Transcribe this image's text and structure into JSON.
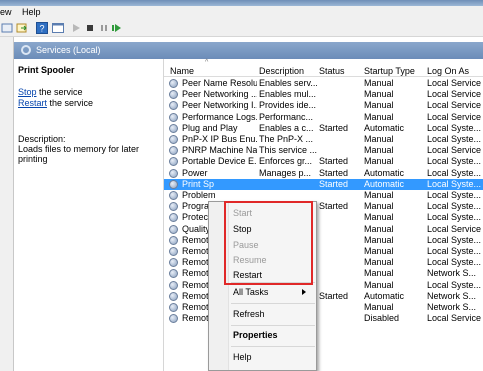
{
  "menu": {
    "view_label": "ew",
    "help_label": "Help"
  },
  "header": {
    "title": "Services (Local)"
  },
  "description_panel": {
    "service_title": "Print Spooler",
    "stop_link": "Stop",
    "stop_suffix": " the service",
    "restart_link": "Restart",
    "restart_suffix": " the service",
    "description_label": "Description:",
    "description_line1": "Loads files to memory for later",
    "description_line2": "printing"
  },
  "columns": {
    "name": "Name",
    "description": "Description",
    "status": "Status",
    "startup_type": "Startup Type",
    "log_on_as": "Log On As"
  },
  "rows": [
    {
      "name": "Peer Name Resolu...",
      "description": "Enables serv...",
      "status": "",
      "startup": "Manual",
      "logon": "Local Service"
    },
    {
      "name": "Peer Networking ...",
      "description": "Enables mul...",
      "status": "",
      "startup": "Manual",
      "logon": "Local Service"
    },
    {
      "name": "Peer Networking I...",
      "description": "Provides ide...",
      "status": "",
      "startup": "Manual",
      "logon": "Local Service"
    },
    {
      "name": "Performance Logs...",
      "description": "Performanc...",
      "status": "",
      "startup": "Manual",
      "logon": "Local Service"
    },
    {
      "name": "Plug and Play",
      "description": "Enables a c...",
      "status": "Started",
      "startup": "Automatic",
      "logon": "Local Syste..."
    },
    {
      "name": "PnP-X IP Bus Enu...",
      "description": "The PnP-X ...",
      "status": "",
      "startup": "Manual",
      "logon": "Local Syste..."
    },
    {
      "name": "PNRP Machine Na...",
      "description": "This service ...",
      "status": "",
      "startup": "Manual",
      "logon": "Local Service"
    },
    {
      "name": "Portable Device E...",
      "description": "Enforces gr...",
      "status": "Started",
      "startup": "Manual",
      "logon": "Local Syste..."
    },
    {
      "name": "Power",
      "description": "Manages p...",
      "status": "Started",
      "startup": "Automatic",
      "logon": "Local Syste..."
    },
    {
      "name": "Print Sp",
      "description": "",
      "status": "Started",
      "startup": "Automatic",
      "logon": "Local Syste..."
    },
    {
      "name": "Problem",
      "description": "",
      "status": "",
      "startup": "Manual",
      "logon": "Local Syste..."
    },
    {
      "name": "Program",
      "description": "",
      "status": "Started",
      "startup": "Manual",
      "logon": "Local Syste..."
    },
    {
      "name": "Protecte",
      "description": "",
      "status": "",
      "startup": "Manual",
      "logon": "Local Syste..."
    },
    {
      "name": "Quality",
      "description": "",
      "status": "",
      "startup": "Manual",
      "logon": "Local Service"
    },
    {
      "name": "Remote",
      "description": "",
      "status": "",
      "startup": "Manual",
      "logon": "Local Syste..."
    },
    {
      "name": "Remote",
      "description": "",
      "status": "",
      "startup": "Manual",
      "logon": "Local Syste..."
    },
    {
      "name": "Remote",
      "description": "",
      "status": "",
      "startup": "Manual",
      "logon": "Local Syste..."
    },
    {
      "name": "Remote",
      "description": "",
      "status": "",
      "startup": "Manual",
      "logon": "Network S..."
    },
    {
      "name": "Remote",
      "description": "",
      "status": "",
      "startup": "Manual",
      "logon": "Local Syste..."
    },
    {
      "name": "Remote",
      "description": "",
      "status": "Started",
      "startup": "Automatic",
      "logon": "Network S..."
    },
    {
      "name": "Remote",
      "description": "",
      "status": "",
      "startup": "Manual",
      "logon": "Network S..."
    },
    {
      "name": "Remote Registry",
      "description": "Enables rem...",
      "status": "",
      "startup": "Disabled",
      "logon": "Local Service"
    }
  ],
  "context_menu": {
    "start": "Start",
    "stop": "Stop",
    "pause": "Pause",
    "resume": "Resume",
    "restart": "Restart",
    "all_tasks": "All Tasks",
    "refresh": "Refresh",
    "properties": "Properties",
    "help": "Help"
  },
  "colors": {
    "selection": "#3399ff",
    "highlight_box": "#e02828",
    "link": "#0645ad"
  }
}
